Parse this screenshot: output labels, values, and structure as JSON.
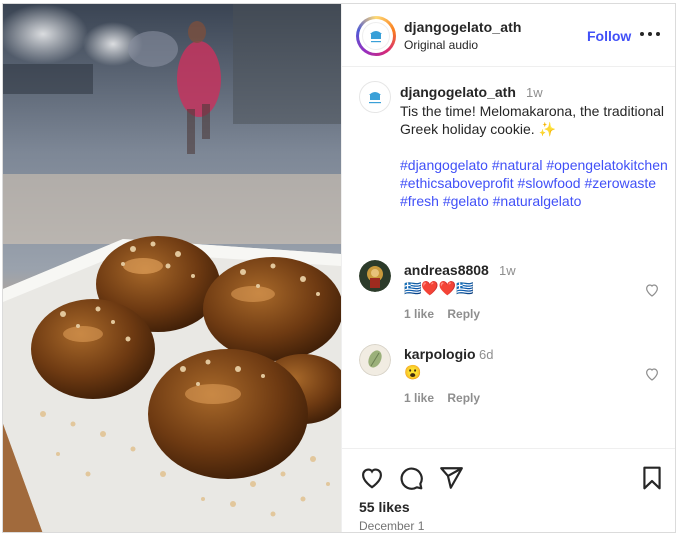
{
  "post": {
    "username": "djangogelato_ath",
    "audio": "Original audio",
    "follow_label": "Follow"
  },
  "caption": {
    "username": "djangogelato_ath",
    "time": "1w",
    "text": "Tis the time! Melomakarona, the traditional Greek holiday cookie. ✨",
    "hashtags": [
      "#djangogelato",
      "#natural",
      "#opengelatokitchen",
      "#ethicsaboveprofit",
      "#slowfood",
      "#zerowaste",
      "#fresh",
      "#gelato",
      "#naturalgelato"
    ]
  },
  "comments": [
    {
      "username": "andreas8808",
      "time": "1w",
      "text": "🇬🇷❤️❤️🇬🇷",
      "likes": "1 like",
      "reply": "Reply"
    },
    {
      "username": "karpologio",
      "time": "6d",
      "text": "😮",
      "likes": "1 like",
      "reply": "Reply"
    }
  ],
  "footer": {
    "likes": "55 likes",
    "date": "December 1"
  },
  "icons": {
    "like": "heart-icon",
    "comment": "comment-icon",
    "share": "share-icon",
    "save": "bookmark-icon",
    "more": "more-icon"
  },
  "colors": {
    "link": "#4150f7",
    "muted": "#8e8e8e",
    "border": "#efefef"
  }
}
